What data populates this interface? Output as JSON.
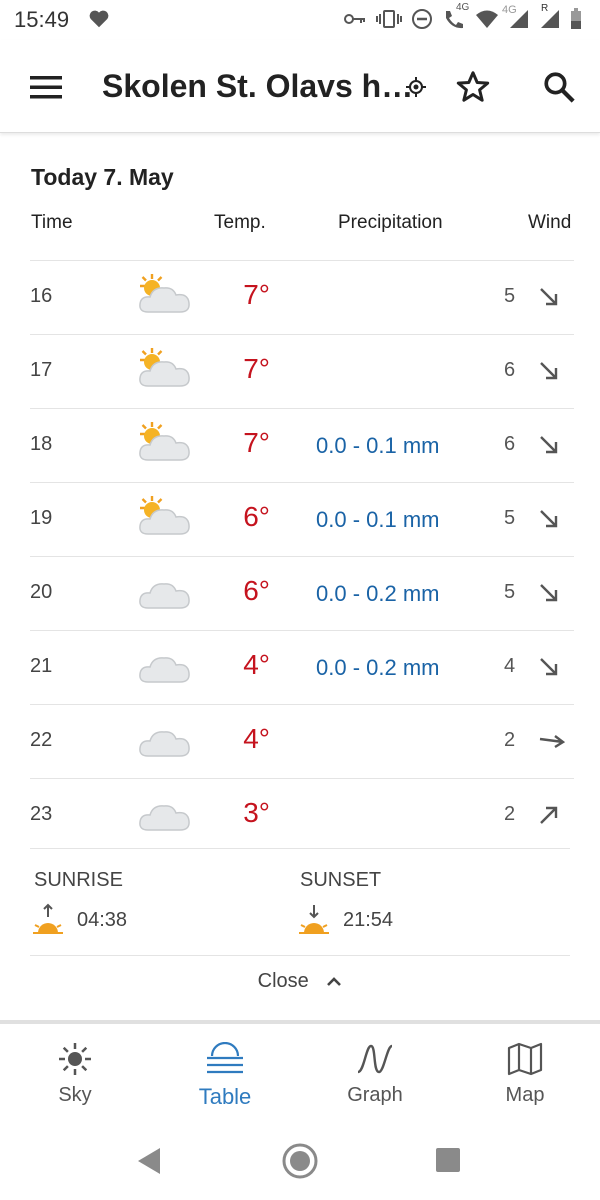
{
  "status": {
    "time": "15:49",
    "network_label": "4G",
    "network_label2": "4G",
    "roaming": "R"
  },
  "appbar": {
    "title": "Skolen St. Olavs h…",
    "icons": [
      "menu-icon",
      "location-icon",
      "star-icon",
      "search-icon"
    ]
  },
  "day": {
    "title": "Today 7. May",
    "headers": {
      "time": "Time",
      "temp": "Temp.",
      "precip": "Precipitation",
      "wind": "Wind"
    },
    "rows": [
      {
        "time": "16",
        "icon": "partly-cloudy-icon",
        "temp": "7°",
        "precip": "",
        "wind": "5",
        "dir": "southeast-arrow-icon"
      },
      {
        "time": "17",
        "icon": "partly-cloudy-icon",
        "temp": "7°",
        "precip": "",
        "wind": "6",
        "dir": "southeast-arrow-icon"
      },
      {
        "time": "18",
        "icon": "partly-cloudy-icon",
        "temp": "7°",
        "precip": "0.0 - 0.1 mm",
        "wind": "6",
        "dir": "southeast-arrow-icon"
      },
      {
        "time": "19",
        "icon": "partly-cloudy-icon",
        "temp": "6°",
        "precip": "0.0 - 0.1 mm",
        "wind": "5",
        "dir": "southeast-arrow-icon"
      },
      {
        "time": "20",
        "icon": "cloud-icon",
        "temp": "6°",
        "precip": "0.0 - 0.2 mm",
        "wind": "5",
        "dir": "southeast-arrow-icon"
      },
      {
        "time": "21",
        "icon": "cloud-icon",
        "temp": "4°",
        "precip": "0.0 - 0.2 mm",
        "wind": "4",
        "dir": "southeast-arrow-icon"
      },
      {
        "time": "22",
        "icon": "cloud-icon",
        "temp": "4°",
        "precip": "",
        "wind": "2",
        "dir": "east-arrow-icon"
      },
      {
        "time": "23",
        "icon": "cloud-icon",
        "temp": "3°",
        "precip": "",
        "wind": "2",
        "dir": "northeast-arrow-icon"
      }
    ]
  },
  "sun": {
    "sunrise_label": "SUNRISE",
    "sunrise_time": "04:38",
    "sunset_label": "SUNSET",
    "sunset_time": "21:54"
  },
  "close_label": "Close",
  "nav": {
    "items": [
      {
        "label": "Sky",
        "icon": "sun-icon"
      },
      {
        "label": "Table",
        "icon": "table-icon",
        "active": true
      },
      {
        "label": "Graph",
        "icon": "graph-icon"
      },
      {
        "label": "Map",
        "icon": "map-icon"
      }
    ]
  },
  "colors": {
    "temp": "#c5131e",
    "precip": "#1a63a6",
    "accent": "#2f7bbf",
    "sun": "#f0a020"
  }
}
